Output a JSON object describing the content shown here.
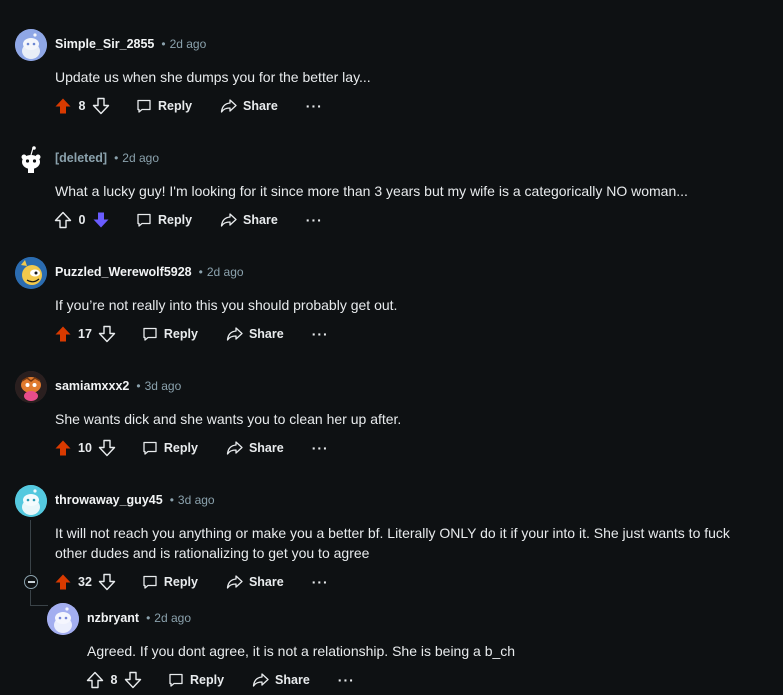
{
  "comments": [
    {
      "author": "Simple_Sir_2855",
      "time": "2d ago",
      "text": "Update us when she dumps you for the better lay...",
      "score": "8",
      "vote": "up",
      "reply_label": "Reply",
      "share_label": "Share",
      "more_label": "···",
      "avatar": "snoo-blue"
    },
    {
      "author": "[deleted]",
      "time": "2d ago",
      "text": "What a lucky guy! I'm looking for it since more than 3 years but my wife is a categorically NO woman...",
      "score": "0",
      "vote": "down",
      "reply_label": "Reply",
      "share_label": "Share",
      "more_label": "···",
      "avatar": "snoo-deleted"
    },
    {
      "author": "Puzzled_Werewolf5928",
      "time": "2d ago",
      "text": "If you’re not really into this you should probably get out.",
      "score": "17",
      "vote": "up",
      "reply_label": "Reply",
      "share_label": "Share",
      "more_label": "···",
      "avatar": "snoo-yellow"
    },
    {
      "author": "samiamxxx2",
      "time": "3d ago",
      "text": "She wants dick and she wants you to clean her up after.",
      "score": "10",
      "vote": "up",
      "reply_label": "Reply",
      "share_label": "Share",
      "more_label": "···",
      "avatar": "snoo-orange"
    },
    {
      "author": "throwaway_guy45",
      "time": "3d ago",
      "text": "It will not reach you anything or make you a better bf. Literally ONLY do it if your into it. She just wants to fuck other dudes and is rationalizing to get you to agree",
      "score": "32",
      "vote": "up",
      "reply_label": "Reply",
      "share_label": "Share",
      "more_label": "···",
      "avatar": "snoo-cyan"
    },
    {
      "author": "nzbryant",
      "time": "2d ago",
      "text": "Agreed. If you dont agree, it is not a relationship. She is being a b_ch",
      "score": "8",
      "vote": "none",
      "reply_label": "Reply",
      "share_label": "Share",
      "more_label": "···",
      "avatar": "snoo-lavender"
    }
  ],
  "separator": "•",
  "colors": {
    "background": "#0e1113",
    "upvote": "#d93a00",
    "downvote": "#6a5cff",
    "muted": "#8ba2ad"
  }
}
